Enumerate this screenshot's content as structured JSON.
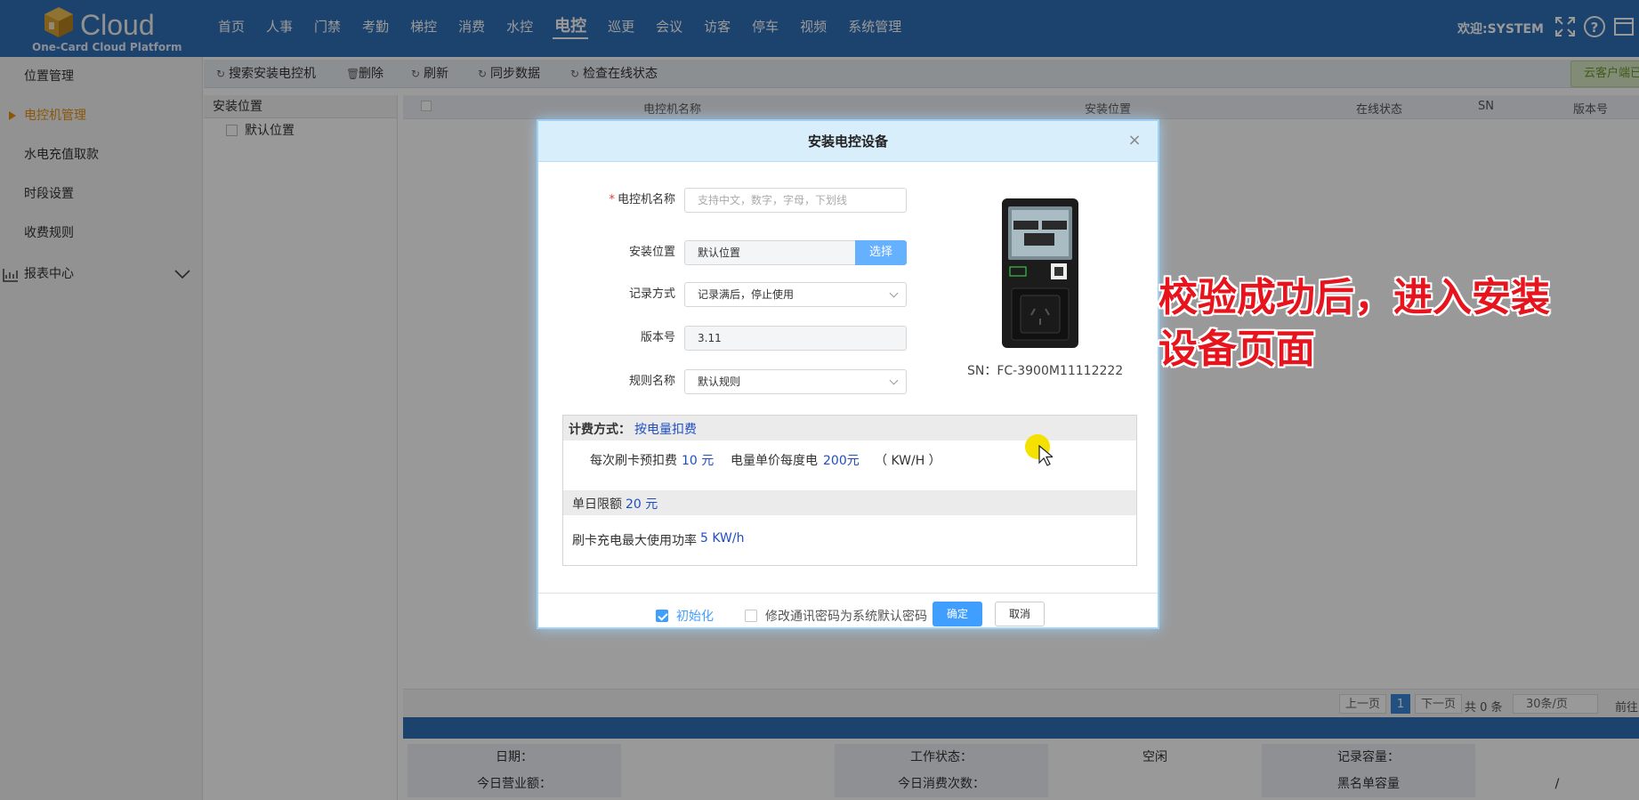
{
  "header": {
    "brand": "Cloud",
    "subtitle": "One-Card Cloud Platform",
    "nav": [
      "首页",
      "人事",
      "门禁",
      "考勤",
      "梯控",
      "消费",
      "水控",
      "电控",
      "巡更",
      "会议",
      "访客",
      "停车",
      "视频",
      "系统管理"
    ],
    "active_nav": "电控",
    "welcome": "欢迎:SYSTEM",
    "icons": [
      "fullscreen-icon",
      "help-icon",
      "window-icon"
    ]
  },
  "sidebar": {
    "items": [
      {
        "label": "位置管理"
      },
      {
        "label": "电控机管理"
      },
      {
        "label": "水电充值取款"
      },
      {
        "label": "时段设置"
      },
      {
        "label": "收费规则"
      },
      {
        "label": "报表中心"
      }
    ],
    "active": "电控机管理"
  },
  "toolbar": {
    "search_install": "搜索安装电控机",
    "delete": "删除",
    "refresh": "刷新",
    "sync": "同步数据",
    "check_online": "检查在线状态",
    "cloud_client": "云客户端已"
  },
  "tree": {
    "header": "安装位置",
    "nodes": [
      "默认位置"
    ]
  },
  "grid": {
    "columns": [
      "电控机名称",
      "安装位置",
      "在线状态",
      "SN",
      "版本号"
    ]
  },
  "pager": {
    "prev": "上一页",
    "page": "1",
    "next": "下一页",
    "total": "共 0 条",
    "per_page": "30条/页",
    "goto": "前往"
  },
  "info": {
    "row1": [
      "日期：",
      "",
      "工作状态：",
      "空闲",
      "记录容量：",
      ""
    ],
    "row2": [
      "今日营业额：",
      "",
      "今日消费次数：",
      "",
      "黑名单容量",
      "/"
    ]
  },
  "dialog": {
    "title": "安装电控设备",
    "fields": {
      "name_label": "电控机名称",
      "name_placeholder": "支持中文，数字，字母，下划线",
      "location_label": "安装位置",
      "location_value": "默认位置",
      "location_button": "选择",
      "record_label": "记录方式",
      "record_value": "记录满后，停止使用",
      "version_label": "版本号",
      "version_value": "3.11",
      "rule_label": "规则名称",
      "rule_value": "默认规则"
    },
    "device": {
      "sn": "SN：FC-3900M11112222"
    },
    "fee": {
      "mode_label": "计费方式：",
      "mode_value": "按电量扣费",
      "prepay_label": "每次刷卡预扣费",
      "prepay_value": "10 元",
      "unit_label": "电量单价每度电",
      "unit_value": "200元",
      "unit_suffix": "（ KW/H ）",
      "daily_label": "单日限额",
      "daily_value": "20 元",
      "power_label": "刷卡充电最大使用功率",
      "power_value": "5 KW/h"
    },
    "footer": {
      "init_label": "初始化",
      "init_checked": true,
      "password_label": "修改通讯密码为系统默认密码",
      "password_checked": false,
      "ok": "确定",
      "cancel": "取消"
    }
  },
  "annotation": {
    "line1": "校验成功后，进入安装",
    "line2": "设备页面"
  },
  "colors": {
    "header_bg": "#2f6fb7",
    "active_sidebar": "#e6920f",
    "primary_button": "#409eff",
    "annotation_text": "#e8141d",
    "value_blue": "#1f4ec2"
  }
}
